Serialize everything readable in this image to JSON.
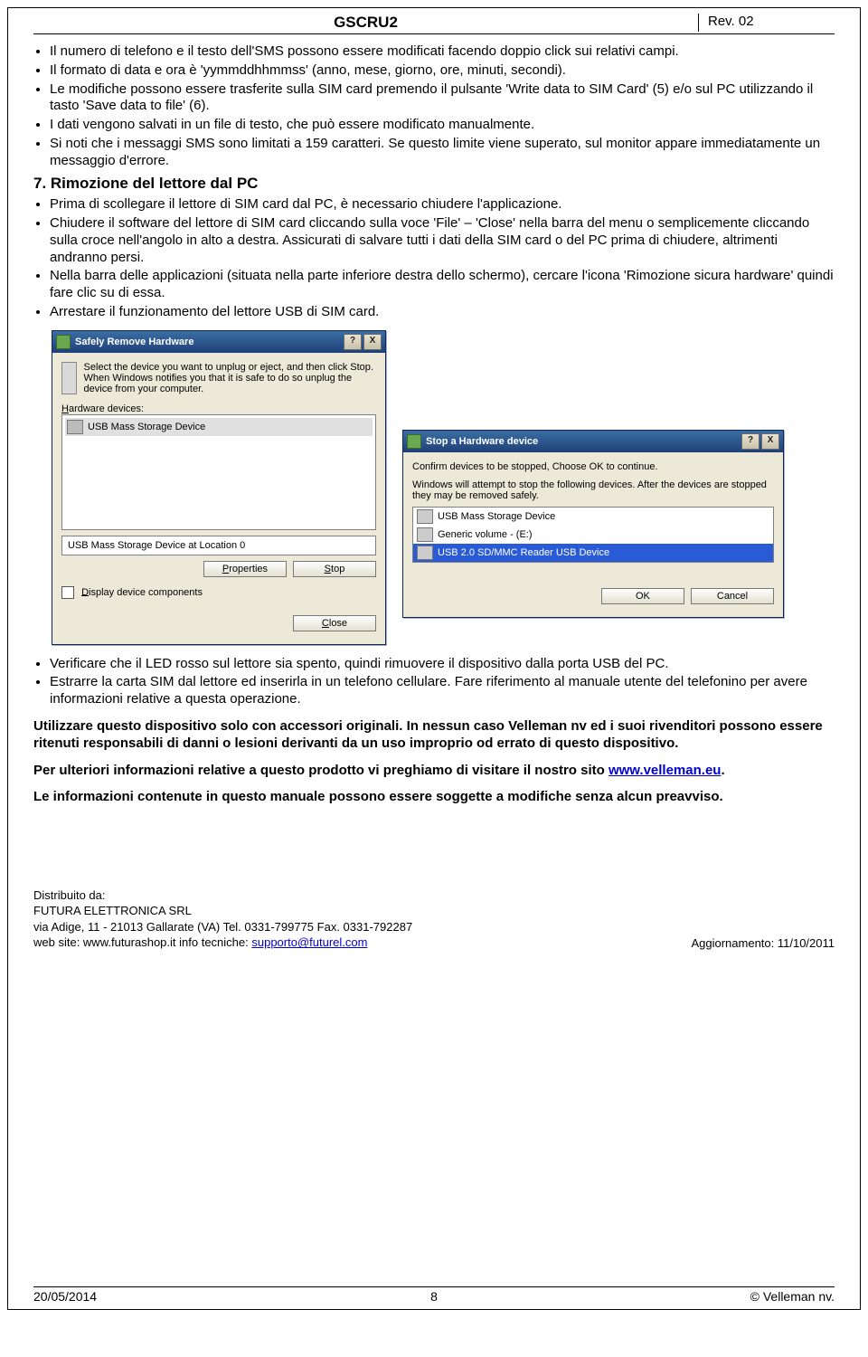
{
  "header": {
    "title": "GSCRU2",
    "rev": "Rev. 02"
  },
  "bullets1": [
    "Il numero di telefono e il testo dell'SMS possono essere modificati facendo doppio click sui relativi campi.",
    "Il formato di data e ora è 'yymmddhhmmss' (anno, mese, giorno, ore, minuti, secondi).",
    "Le modifiche possono essere trasferite sulla SIM card premendo il pulsante 'Write data to SIM Card' (5) e/o sul PC utilizzando il tasto 'Save data to file' (6).",
    "I dati vengono salvati in un file di testo, che può essere modificato manualmente.",
    "Si noti che i messaggi SMS sono limitati a 159 caratteri. Se questo limite viene superato, sul monitor appare immediatamente un messaggio d'errore."
  ],
  "section7": "7. Rimozione del lettore dal PC",
  "bullets2": [
    "Prima di scollegare il lettore di SIM card dal PC, è necessario chiudere l'applicazione.",
    "Chiudere il software del lettore di SIM card cliccando sulla voce  'File' – 'Close' nella barra del menu o semplicemente cliccando sulla croce nell'angolo in alto a destra. Assicurati di salvare tutti i dati della SIM card o del PC prima di chiudere, altrimenti andranno persi.",
    "Nella barra delle applicazioni (situata nella parte inferiore destra dello schermo), cercare l'icona 'Rimozione sicura hardware' quindi fare clic su di essa.",
    "Arrestare il funzionamento del lettore USB di SIM card."
  ],
  "dlg1": {
    "title": "Safely Remove Hardware",
    "desc": "Select the device you want to unplug or eject, and then click Stop. When Windows notifies you that it is safe to do so unplug the device from your computer.",
    "label_devices": "Hardware devices:",
    "device": "USB Mass Storage Device",
    "status": "USB Mass Storage Device at Location 0",
    "btn_properties": "Properties",
    "btn_stop": "Stop",
    "chk_label": "Display device components",
    "btn_close": "Close"
  },
  "dlg2": {
    "title": "Stop a Hardware device",
    "line1": "Confirm devices to be stopped, Choose OK to continue.",
    "line2": "Windows will attempt to stop the following devices. After the devices are stopped they may be removed safely.",
    "dev1": "USB Mass Storage Device",
    "dev2": "Generic volume - (E:)",
    "dev3": "USB 2.0 SD/MMC Reader USB Device",
    "btn_ok": "OK",
    "btn_cancel": "Cancel"
  },
  "bullets3": [
    "Verificare che il LED rosso sul lettore sia spento, quindi rimuovere il dispositivo dalla porta USB del PC.",
    "Estrarre la carta SIM dal lettore ed inserirla in un telefono cellulare. Fare riferimento al manuale utente del telefonino per avere informazioni relative a questa operazione."
  ],
  "warn": "Utilizzare questo dispositivo solo con accessori originali. In nessun caso Velleman nv ed i suoi rivenditori possono essere ritenuti responsabili di danni o lesioni derivanti da un uso improprio od errato di questo dispositivo.",
  "moreinfo_pre": "Per ulteriori informazioni relative a questo prodotto vi preghiamo di visitare il nostro sito ",
  "moreinfo_link": "www.velleman.eu",
  "moreinfo_post": ".",
  "disclaimer": "Le informazioni contenute in questo manuale possono essere soggette a modifiche senza alcun preavviso.",
  "distro": {
    "l1": "Distribuito da:",
    "l2": "FUTURA ELETTRONICA SRL",
    "l3": "via Adige, 11 - 21013 Gallarate (VA) Tel. 0331-799775 Fax. 0331-792287",
    "l4a": "web site: www.futurashop.it   info tecniche: ",
    "l4link": "supporto@futurel.com",
    "update": "Aggiornamento: 11/10/2011"
  },
  "footer": {
    "left": "20/05/2014",
    "center": "8",
    "right": "© Velleman nv."
  }
}
